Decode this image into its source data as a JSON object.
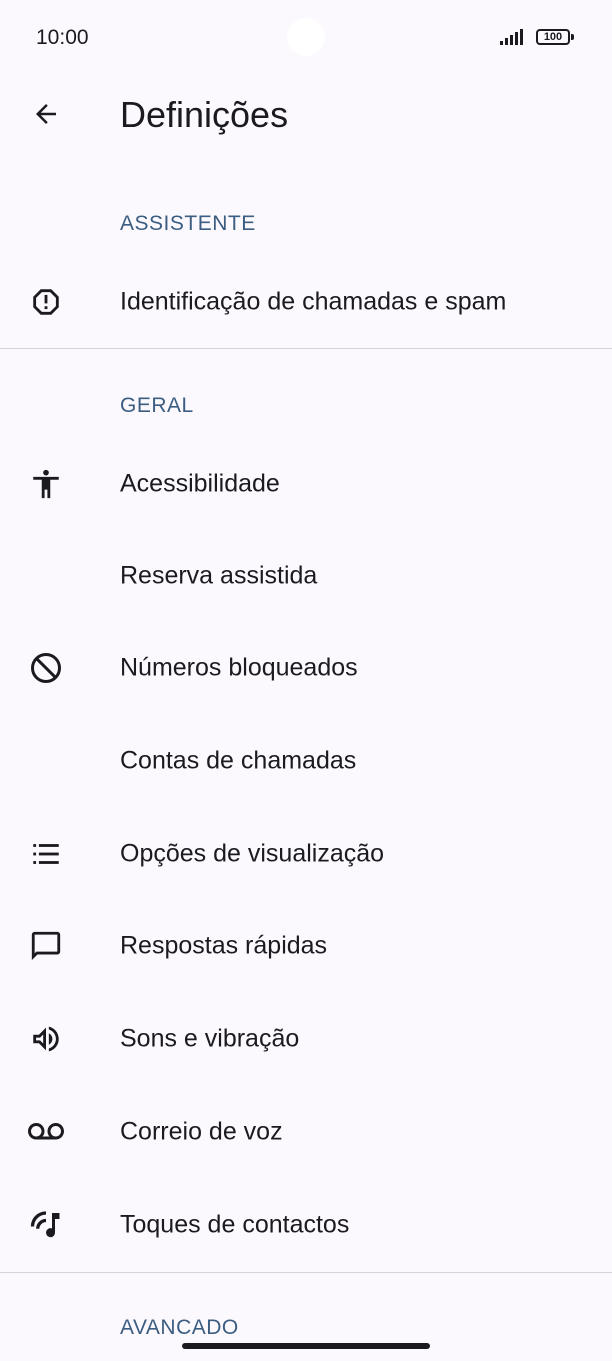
{
  "status": {
    "time": "10:00",
    "battery": "100"
  },
  "header": {
    "title": "Definições"
  },
  "sections": {
    "assistant": {
      "title": "ASSISTENTE",
      "items": [
        {
          "label": "Identificação de chamadas e spam",
          "icon": "alert-octagon-icon"
        }
      ]
    },
    "general": {
      "title": "GERAL",
      "items": [
        {
          "label": "Acessibilidade",
          "icon": "accessibility-icon"
        },
        {
          "label": "Reserva assistida",
          "icon": ""
        },
        {
          "label": "Números bloqueados",
          "icon": "block-icon"
        },
        {
          "label": "Contas de chamadas",
          "icon": ""
        },
        {
          "label": "Opções de visualização",
          "icon": "list-icon"
        },
        {
          "label": "Respostas rápidas",
          "icon": "chat-bubble-icon"
        },
        {
          "label": "Sons e vibração",
          "icon": "volume-icon"
        },
        {
          "label": "Correio de voz",
          "icon": "voicemail-icon"
        },
        {
          "label": "Toques de contactos",
          "icon": "ringtone-icon"
        }
      ]
    },
    "advanced": {
      "title": "AVANÇADO"
    }
  }
}
